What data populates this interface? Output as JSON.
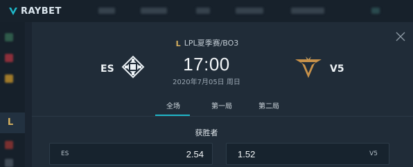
{
  "brand": {
    "name": "RAYBET"
  },
  "match": {
    "league": "LPL夏季赛/BO3",
    "time": "17:00",
    "date": "2020年7月05日 周日",
    "home": {
      "name": "ES"
    },
    "away": {
      "name": "V5"
    }
  },
  "tabs": [
    {
      "label": "全场",
      "active": true
    },
    {
      "label": "第一局",
      "active": false
    },
    {
      "label": "第二局",
      "active": false
    }
  ],
  "market": {
    "title": "获胜者",
    "options": [
      {
        "label": "ES",
        "odds": "2.54"
      },
      {
        "label": "V5",
        "odds": "1.52"
      }
    ]
  },
  "colors": {
    "accent": "#1fb7c9",
    "lol_gold": "#d8b260",
    "panel": "#202c38",
    "background": "#1b2631"
  },
  "icons": {
    "close": "close-icon",
    "league": "lol-icon",
    "brand": "raybet-logo-icon"
  }
}
